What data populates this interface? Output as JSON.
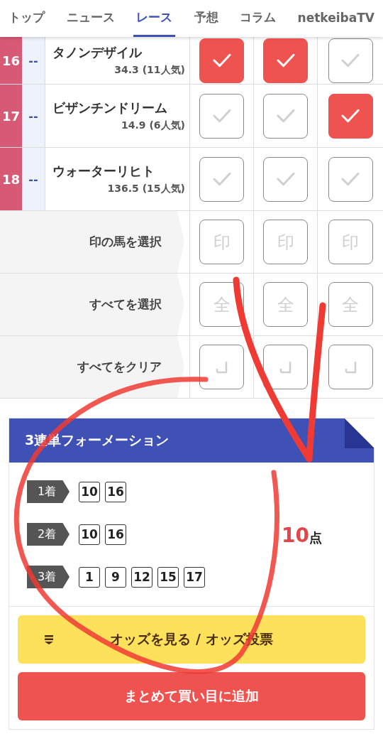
{
  "tabs": [
    {
      "label": "トップ",
      "selected": false
    },
    {
      "label": "ニュース",
      "selected": false
    },
    {
      "label": "レース",
      "selected": true
    },
    {
      "label": "予想",
      "selected": false
    },
    {
      "label": "コラム",
      "selected": false
    },
    {
      "label": "netkeibaTV",
      "selected": false
    }
  ],
  "horses": [
    {
      "number": "16",
      "mark": "--",
      "name": "タノンデザイル",
      "odds": "34.3 (11人気)",
      "picks": [
        {
          "checked": true
        },
        {
          "checked": true
        },
        {
          "checked": false
        }
      ]
    },
    {
      "number": "17",
      "mark": "--",
      "name": "ビザンチンドリーム",
      "odds": "14.9 (6人気)",
      "picks": [
        {
          "checked": false
        },
        {
          "checked": false
        },
        {
          "checked": true
        }
      ]
    },
    {
      "number": "18",
      "mark": "--",
      "name": "ウォーターリヒト",
      "odds": "136.5 (15人気)",
      "picks": [
        {
          "checked": false
        },
        {
          "checked": false
        },
        {
          "checked": false
        }
      ]
    }
  ],
  "action_rows": [
    {
      "label": "印の馬を選択",
      "buttons": [
        {
          "kind": "char",
          "text": "印"
        },
        {
          "kind": "char",
          "text": "印"
        },
        {
          "kind": "char",
          "text": "印"
        }
      ]
    },
    {
      "label": "すべてを選択",
      "buttons": [
        {
          "kind": "char",
          "text": "全"
        },
        {
          "kind": "char",
          "text": "全"
        },
        {
          "kind": "char",
          "text": "全"
        }
      ]
    },
    {
      "label": "すべてをクリア",
      "buttons": [
        {
          "kind": "clear"
        },
        {
          "kind": "clear"
        },
        {
          "kind": "clear"
        }
      ]
    }
  ],
  "formation": {
    "title": "3連単フォーメーション",
    "places": [
      {
        "label": "1着",
        "numbers": [
          "10",
          "16"
        ]
      },
      {
        "label": "2着",
        "numbers": [
          "10",
          "16"
        ]
      },
      {
        "label": "3着",
        "numbers": [
          "1",
          "9",
          "12",
          "15",
          "17"
        ]
      }
    ],
    "total": {
      "count": "10",
      "unit": "点"
    },
    "buttons": [
      {
        "kind": "odds",
        "label": "オッズを見る / オッズ投票"
      },
      {
        "kind": "add",
        "label": "まとめて買い目に追加"
      }
    ]
  }
}
